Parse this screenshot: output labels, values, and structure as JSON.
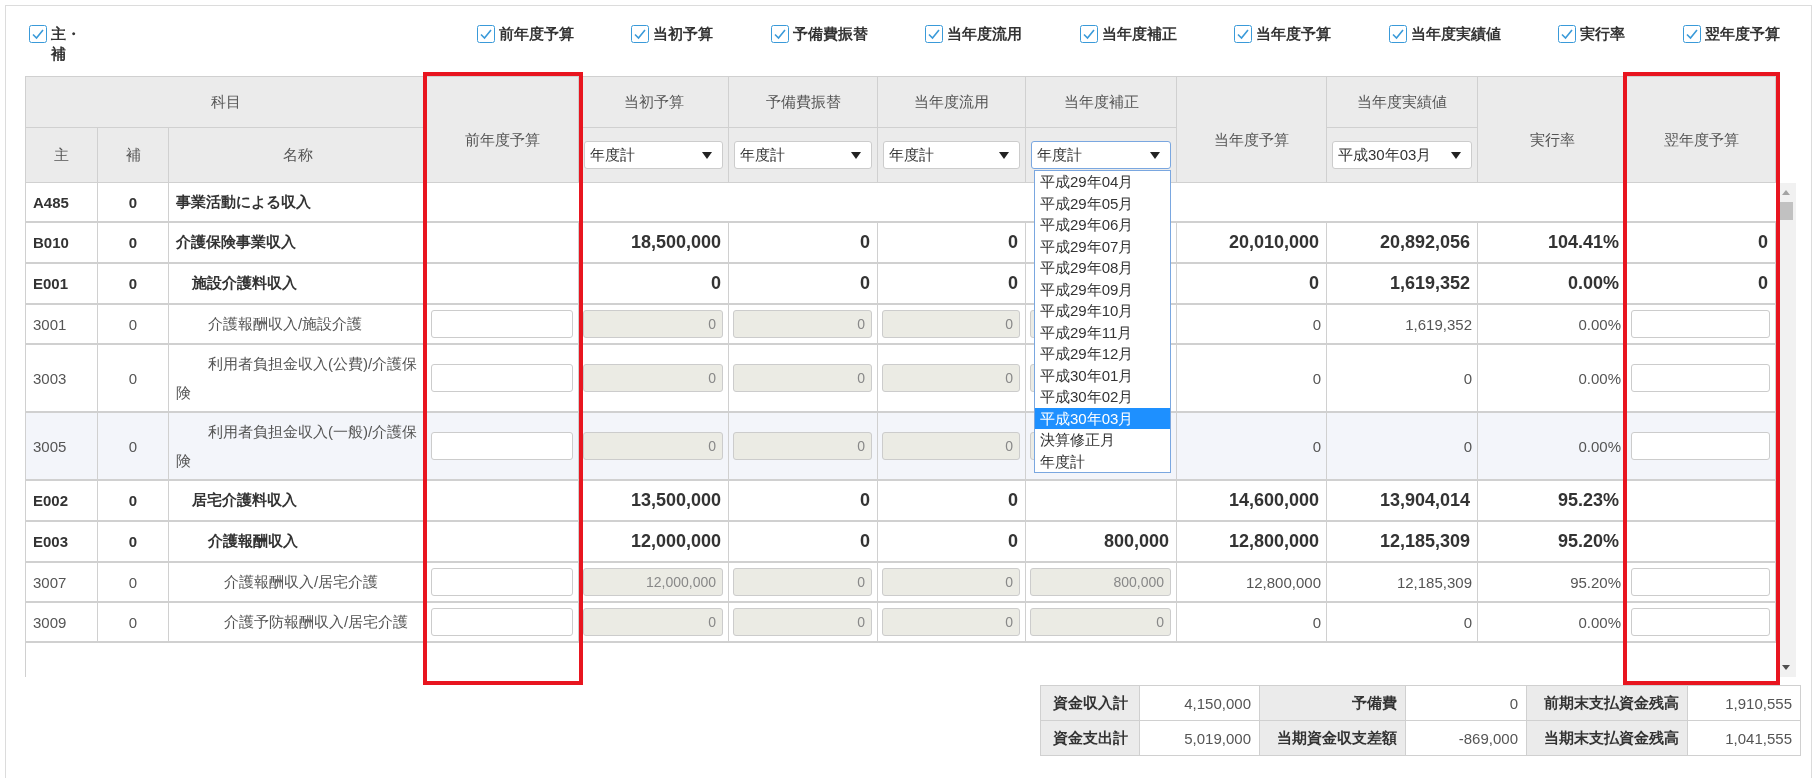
{
  "filters": [
    {
      "label": "主・補",
      "checked": true
    },
    {
      "label": "前年度予算",
      "checked": true
    },
    {
      "label": "当初予算",
      "checked": true
    },
    {
      "label": "予備費振替",
      "checked": true
    },
    {
      "label": "当年度流用",
      "checked": true
    },
    {
      "label": "当年度補正",
      "checked": true
    },
    {
      "label": "当年度予算",
      "checked": true
    },
    {
      "label": "当年度実績値",
      "checked": true
    },
    {
      "label": "実行率",
      "checked": true
    },
    {
      "label": "翌年度予算",
      "checked": true
    }
  ],
  "header": {
    "group": "科目",
    "code": "主",
    "sub": "補",
    "name": "名称"
  },
  "columns": [
    {
      "label": "前年度予算",
      "highlighted": true
    },
    {
      "label": "当初予算",
      "select": "年度計",
      "open": false,
      "highlighted": false
    },
    {
      "label": "予備費振替",
      "select": "年度計",
      "open": false,
      "highlighted": false
    },
    {
      "label": "当年度流用",
      "select": "年度計",
      "open": false,
      "highlighted": false
    },
    {
      "label": "当年度補正",
      "select": "年度計",
      "open": true,
      "highlighted": false,
      "options": [
        {
          "label": "平成29年04月",
          "selected": false
        },
        {
          "label": "平成29年05月",
          "selected": false
        },
        {
          "label": "平成29年06月",
          "selected": false
        },
        {
          "label": "平成29年07月",
          "selected": false
        },
        {
          "label": "平成29年08月",
          "selected": false
        },
        {
          "label": "平成29年09月",
          "selected": false
        },
        {
          "label": "平成29年10月",
          "selected": false
        },
        {
          "label": "平成29年11月",
          "selected": false
        },
        {
          "label": "平成29年12月",
          "selected": false
        },
        {
          "label": "平成30年01月",
          "selected": false
        },
        {
          "label": "平成30年02月",
          "selected": false
        },
        {
          "label": "平成30年03月",
          "selected": true
        },
        {
          "label": "決算修正月",
          "selected": false
        },
        {
          "label": "年度計",
          "selected": false
        }
      ]
    },
    {
      "label": "当年度予算",
      "highlighted": false
    },
    {
      "label": "当年度実績値",
      "select": "平成30年03月",
      "open": false,
      "highlighted": false
    },
    {
      "label": "実行率",
      "highlighted": false
    },
    {
      "label": "翌年度予算",
      "highlighted": true
    }
  ],
  "rows": [
    {
      "code": "A485",
      "sub": "0",
      "name": "事業活動による収入",
      "kind": "heading",
      "selected": false
    },
    {
      "code": "B010",
      "sub": "0",
      "name": "介護保険事業収入",
      "kind": "group",
      "selected": false,
      "values": {
        "initial": "18,500,000",
        "reserve": "0",
        "transfer": "0",
        "current": "20,010,000",
        "actual": "20,892,056",
        "rate": "104.41%",
        "next": "0"
      },
      "children": [
        {
          "code": "E001",
          "sub": "0",
          "name": "施設介護料収入",
          "kind": "group",
          "selected": false,
          "values": {
            "initial": "0",
            "reserve": "0",
            "transfer": "0",
            "current": "0",
            "actual": "1,619,352",
            "rate": "0.00%",
            "next": "0"
          },
          "children": [
            {
              "code": "3001",
              "sub": "0",
              "name": "介護報酬収入/施設介護",
              "kind": "entry",
              "selected": false,
              "values": {
                "initial": "0",
                "reserve": "0",
                "transfer": "0",
                "current": "0",
                "actual": "1,619,352",
                "rate": "0.00%"
              }
            },
            {
              "code": "3003",
              "sub": "0",
              "name": "利用者負担金収入(公費)/介護保険",
              "kind": "entry",
              "selected": false,
              "values": {
                "initial": "0",
                "reserve": "0",
                "transfer": "0",
                "current": "0",
                "actual": "0",
                "rate": "0.00%"
              }
            },
            {
              "code": "3005",
              "sub": "0",
              "name": "利用者負担金収入(一般)/介護保険",
              "kind": "entry",
              "selected": true,
              "values": {
                "initial": "0",
                "reserve": "0",
                "transfer": "0",
                "current": "0",
                "actual": "0",
                "rate": "0.00%"
              }
            }
          ]
        },
        {
          "code": "E002",
          "sub": "0",
          "name": "居宅介護料収入",
          "kind": "group",
          "selected": false,
          "values": {
            "initial": "13,500,000",
            "reserve": "0",
            "transfer": "0",
            "current": "14,600,000",
            "actual": "13,904,014",
            "rate": "95.23%"
          },
          "children": [
            {
              "code": "E003",
              "sub": "0",
              "name": "介護報酬収入",
              "kind": "group",
              "selected": false,
              "values": {
                "initial": "12,000,000",
                "reserve": "0",
                "transfer": "0",
                "revision": "800,000",
                "current": "12,800,000",
                "actual": "12,185,309",
                "rate": "95.20%"
              },
              "children": [
                {
                  "code": "3007",
                  "sub": "0",
                  "name": "介護報酬収入/居宅介護",
                  "kind": "entry",
                  "selected": false,
                  "values": {
                    "initial": "12,000,000",
                    "reserve": "0",
                    "transfer": "0",
                    "revision": "800,000",
                    "current": "12,800,000",
                    "actual": "12,185,309",
                    "rate": "95.20%"
                  }
                },
                {
                  "code": "3009",
                  "sub": "0",
                  "name": "介護予防報酬収入/居宅介護",
                  "kind": "entry",
                  "selected": false,
                  "values": {
                    "initial": "0",
                    "reserve": "0",
                    "transfer": "0",
                    "revision": "0",
                    "current": "0",
                    "actual": "0",
                    "rate": "0.00%"
                  }
                }
              ]
            }
          ]
        }
      ]
    }
  ],
  "summary": [
    [
      {
        "label": "資金収入計",
        "value": "4,150,000"
      },
      {
        "label": "予備費",
        "value": "0"
      },
      {
        "label": "前期末支払資金残高",
        "value": "1,910,555"
      }
    ],
    [
      {
        "label": "資金支出計",
        "value": "5,019,000"
      },
      {
        "label": "当期資金収支差額",
        "value": "-869,000"
      },
      {
        "label": "当期末支払資金残高",
        "value": "1,041,555"
      }
    ]
  ]
}
